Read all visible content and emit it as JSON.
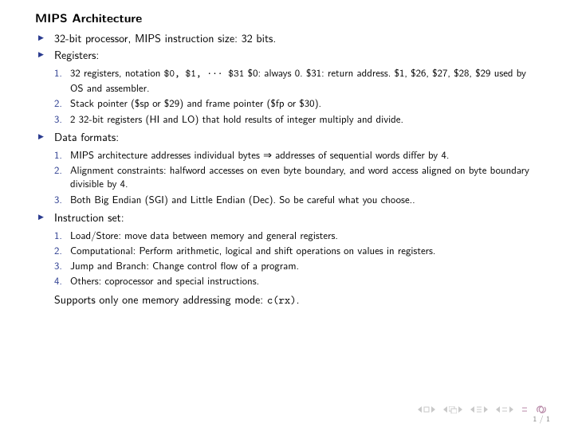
{
  "title": "MIPS Architecture",
  "bullets": {
    "b0": "32-bit processor, MIPS instruction size: 32 bits.",
    "b1": "Registers:",
    "b2": "Data formats:",
    "b3": "Instruction set:"
  },
  "registers": {
    "i1a": "32 registers, notation ",
    "i1code": "$0, $1, ··· $31",
    "i1b": " $0: always 0. $31: return address. $1, $26, $27, $28, $29 used by OS and assembler.",
    "i2": "Stack pointer ($sp or $29) and frame pointer ($fp or $30).",
    "i3": "2 32-bit registers (HI and LO) that hold results of integer multiply and divide."
  },
  "dataformats": {
    "i1": "MIPS architecture addresses individual bytes ⇒ addresses of sequential words differ by 4.",
    "i2": "Alignment constraints: halfword accesses on even byte boundary, and word access aligned on byte boundary divisible by 4.",
    "i3": "Both Big Endian (SGI) and Little Endian (Dec). So be careful what you choose.."
  },
  "instrset": {
    "i1": "Load/Store: move data between memory and general registers.",
    "i2": "Computational: Perform arithmetic, logical and shift operations on values in registers.",
    "i3": "Jump and Branch: Change control flow of a program.",
    "i4": "Others: coprocessor and special instructions."
  },
  "final_a": "Supports only one memory addressing mode: ",
  "final_code": "c(rx)",
  "final_b": ".",
  "nums": {
    "n1": "1.",
    "n2": "2.",
    "n3": "3.",
    "n4": "4."
  },
  "pagenum": "1 / 1"
}
